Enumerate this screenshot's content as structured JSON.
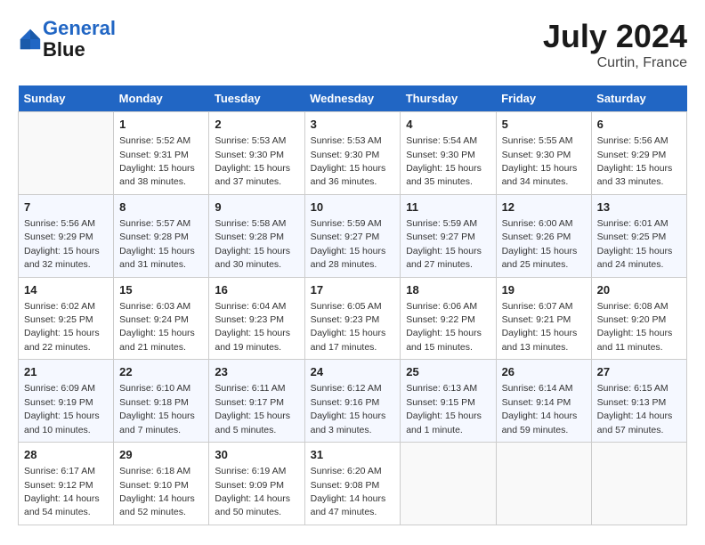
{
  "header": {
    "logo_line1": "General",
    "logo_line2": "Blue",
    "month_year": "July 2024",
    "location": "Curtin, France"
  },
  "calendar": {
    "days_of_week": [
      "Sunday",
      "Monday",
      "Tuesday",
      "Wednesday",
      "Thursday",
      "Friday",
      "Saturday"
    ],
    "weeks": [
      [
        {
          "day": "",
          "content": ""
        },
        {
          "day": "1",
          "content": "Sunrise: 5:52 AM\nSunset: 9:31 PM\nDaylight: 15 hours\nand 38 minutes."
        },
        {
          "day": "2",
          "content": "Sunrise: 5:53 AM\nSunset: 9:30 PM\nDaylight: 15 hours\nand 37 minutes."
        },
        {
          "day": "3",
          "content": "Sunrise: 5:53 AM\nSunset: 9:30 PM\nDaylight: 15 hours\nand 36 minutes."
        },
        {
          "day": "4",
          "content": "Sunrise: 5:54 AM\nSunset: 9:30 PM\nDaylight: 15 hours\nand 35 minutes."
        },
        {
          "day": "5",
          "content": "Sunrise: 5:55 AM\nSunset: 9:30 PM\nDaylight: 15 hours\nand 34 minutes."
        },
        {
          "day": "6",
          "content": "Sunrise: 5:56 AM\nSunset: 9:29 PM\nDaylight: 15 hours\nand 33 minutes."
        }
      ],
      [
        {
          "day": "7",
          "content": "Sunrise: 5:56 AM\nSunset: 9:29 PM\nDaylight: 15 hours\nand 32 minutes."
        },
        {
          "day": "8",
          "content": "Sunrise: 5:57 AM\nSunset: 9:28 PM\nDaylight: 15 hours\nand 31 minutes."
        },
        {
          "day": "9",
          "content": "Sunrise: 5:58 AM\nSunset: 9:28 PM\nDaylight: 15 hours\nand 30 minutes."
        },
        {
          "day": "10",
          "content": "Sunrise: 5:59 AM\nSunset: 9:27 PM\nDaylight: 15 hours\nand 28 minutes."
        },
        {
          "day": "11",
          "content": "Sunrise: 5:59 AM\nSunset: 9:27 PM\nDaylight: 15 hours\nand 27 minutes."
        },
        {
          "day": "12",
          "content": "Sunrise: 6:00 AM\nSunset: 9:26 PM\nDaylight: 15 hours\nand 25 minutes."
        },
        {
          "day": "13",
          "content": "Sunrise: 6:01 AM\nSunset: 9:25 PM\nDaylight: 15 hours\nand 24 minutes."
        }
      ],
      [
        {
          "day": "14",
          "content": "Sunrise: 6:02 AM\nSunset: 9:25 PM\nDaylight: 15 hours\nand 22 minutes."
        },
        {
          "day": "15",
          "content": "Sunrise: 6:03 AM\nSunset: 9:24 PM\nDaylight: 15 hours\nand 21 minutes."
        },
        {
          "day": "16",
          "content": "Sunrise: 6:04 AM\nSunset: 9:23 PM\nDaylight: 15 hours\nand 19 minutes."
        },
        {
          "day": "17",
          "content": "Sunrise: 6:05 AM\nSunset: 9:23 PM\nDaylight: 15 hours\nand 17 minutes."
        },
        {
          "day": "18",
          "content": "Sunrise: 6:06 AM\nSunset: 9:22 PM\nDaylight: 15 hours\nand 15 minutes."
        },
        {
          "day": "19",
          "content": "Sunrise: 6:07 AM\nSunset: 9:21 PM\nDaylight: 15 hours\nand 13 minutes."
        },
        {
          "day": "20",
          "content": "Sunrise: 6:08 AM\nSunset: 9:20 PM\nDaylight: 15 hours\nand 11 minutes."
        }
      ],
      [
        {
          "day": "21",
          "content": "Sunrise: 6:09 AM\nSunset: 9:19 PM\nDaylight: 15 hours\nand 10 minutes."
        },
        {
          "day": "22",
          "content": "Sunrise: 6:10 AM\nSunset: 9:18 PM\nDaylight: 15 hours\nand 7 minutes."
        },
        {
          "day": "23",
          "content": "Sunrise: 6:11 AM\nSunset: 9:17 PM\nDaylight: 15 hours\nand 5 minutes."
        },
        {
          "day": "24",
          "content": "Sunrise: 6:12 AM\nSunset: 9:16 PM\nDaylight: 15 hours\nand 3 minutes."
        },
        {
          "day": "25",
          "content": "Sunrise: 6:13 AM\nSunset: 9:15 PM\nDaylight: 15 hours\nand 1 minute."
        },
        {
          "day": "26",
          "content": "Sunrise: 6:14 AM\nSunset: 9:14 PM\nDaylight: 14 hours\nand 59 minutes."
        },
        {
          "day": "27",
          "content": "Sunrise: 6:15 AM\nSunset: 9:13 PM\nDaylight: 14 hours\nand 57 minutes."
        }
      ],
      [
        {
          "day": "28",
          "content": "Sunrise: 6:17 AM\nSunset: 9:12 PM\nDaylight: 14 hours\nand 54 minutes."
        },
        {
          "day": "29",
          "content": "Sunrise: 6:18 AM\nSunset: 9:10 PM\nDaylight: 14 hours\nand 52 minutes."
        },
        {
          "day": "30",
          "content": "Sunrise: 6:19 AM\nSunset: 9:09 PM\nDaylight: 14 hours\nand 50 minutes."
        },
        {
          "day": "31",
          "content": "Sunrise: 6:20 AM\nSunset: 9:08 PM\nDaylight: 14 hours\nand 47 minutes."
        },
        {
          "day": "",
          "content": ""
        },
        {
          "day": "",
          "content": ""
        },
        {
          "day": "",
          "content": ""
        }
      ]
    ]
  }
}
